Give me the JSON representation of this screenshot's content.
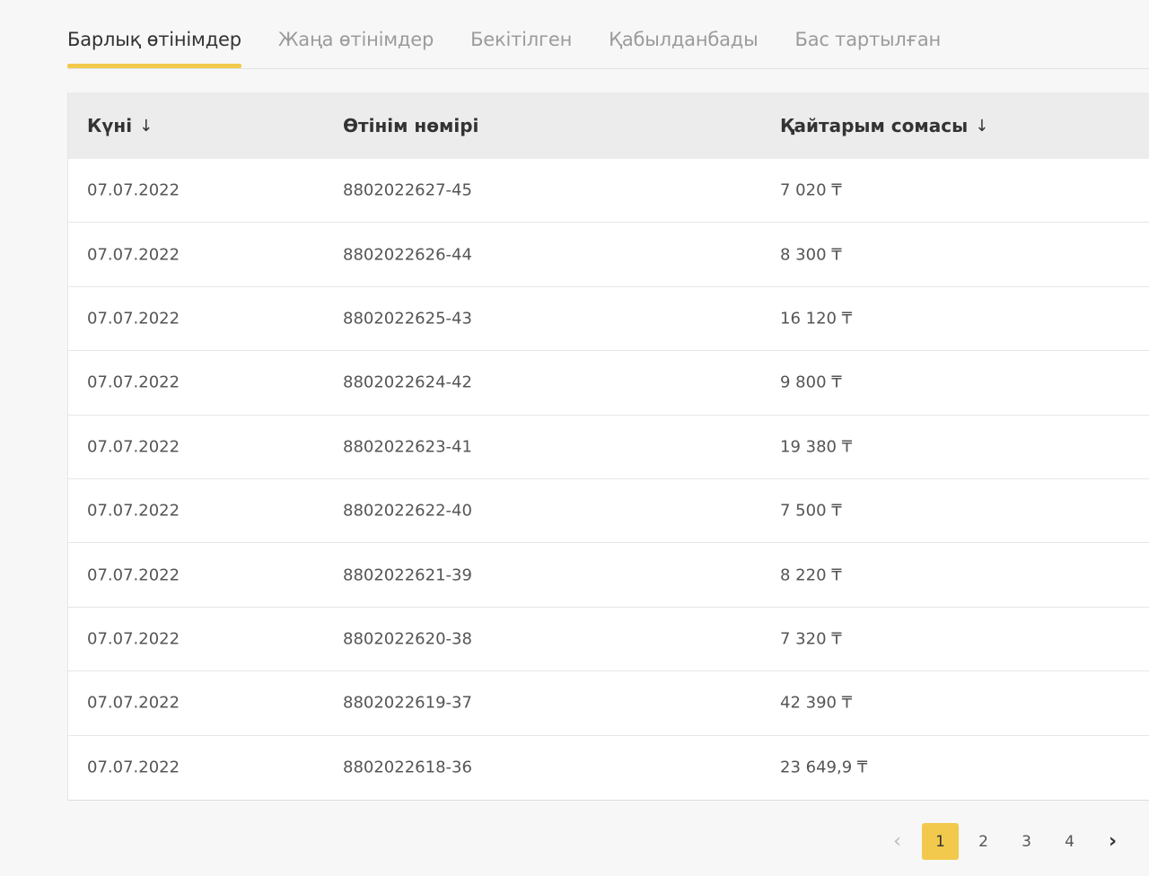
{
  "tabs": [
    {
      "label": "Барлық өтінімдер",
      "active": true
    },
    {
      "label": "Жаңа өтінімдер",
      "active": false
    },
    {
      "label": "Бекітілген",
      "active": false
    },
    {
      "label": "Қабылданбады",
      "active": false
    },
    {
      "label": "Бас тартылған",
      "active": false
    }
  ],
  "table": {
    "headers": {
      "date": "Күні",
      "date_sort_icon": "↓",
      "number": "Өтінім нөмірі",
      "amount": "Қайтарым сомасы",
      "amount_sort_icon": "↓"
    },
    "rows": [
      {
        "date": "07.07.2022",
        "number": "8802022627-45",
        "amount": "7 020 ₸"
      },
      {
        "date": "07.07.2022",
        "number": "8802022626-44",
        "amount": "8 300 ₸"
      },
      {
        "date": "07.07.2022",
        "number": "8802022625-43",
        "amount": "16 120 ₸"
      },
      {
        "date": "07.07.2022",
        "number": "8802022624-42",
        "amount": "9 800 ₸"
      },
      {
        "date": "07.07.2022",
        "number": "8802022623-41",
        "amount": "19 380 ₸"
      },
      {
        "date": "07.07.2022",
        "number": "8802022622-40",
        "amount": "7 500 ₸"
      },
      {
        "date": "07.07.2022",
        "number": "8802022621-39",
        "amount": "8 220 ₸"
      },
      {
        "date": "07.07.2022",
        "number": "8802022620-38",
        "amount": "7 320 ₸"
      },
      {
        "date": "07.07.2022",
        "number": "8802022619-37",
        "amount": "42 390 ₸"
      },
      {
        "date": "07.07.2022",
        "number": "8802022618-36",
        "amount": "23 649,9 ₸"
      }
    ]
  },
  "pagination": {
    "prev_icon": "‹",
    "next_icon": "›",
    "pages": [
      "1",
      "2",
      "3",
      "4"
    ],
    "current": "1"
  },
  "colors": {
    "accent": "#f2c94c",
    "header_bg": "#ececec",
    "page_bg": "#f7f7f7"
  }
}
